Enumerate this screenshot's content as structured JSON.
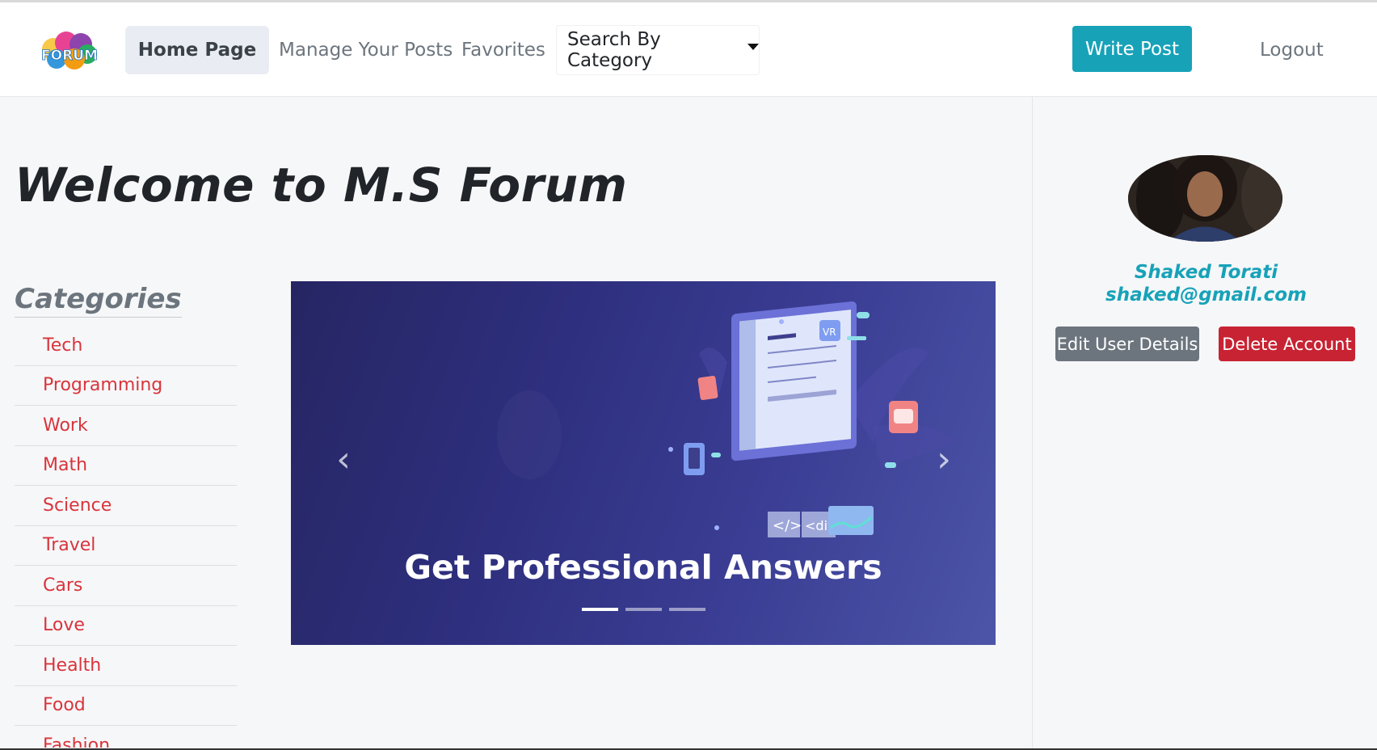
{
  "navbar": {
    "logo_text": "FORUM",
    "home": "Home Page",
    "manage": "Manage Your Posts",
    "favorites": "Favorites",
    "search_category": "Search By Category",
    "write_post": "Write Post",
    "logout": "Logout"
  },
  "main": {
    "welcome": "Welcome to M.S Forum",
    "categories_title": "Categories",
    "categories": [
      "Tech",
      "Programming",
      "Work",
      "Math",
      "Science",
      "Travel",
      "Cars",
      "Love",
      "Health",
      "Food",
      "Fashion"
    ]
  },
  "carousel": {
    "caption": "Get Professional Answers",
    "slide_count": 3,
    "active_slide": 1,
    "monitor_text": [
      "</>",
      "<div"
    ],
    "vr_label": "VR",
    "colors": {
      "bg_start": "#262563",
      "bg_end": "#4c55a8"
    }
  },
  "user": {
    "name": "Shaked Torati",
    "email": "shaked@gmail.com",
    "edit_button": "Edit User Details",
    "delete_button": "Delete Account"
  },
  "colors": {
    "accent": "#17a2b8",
    "danger": "#c82333",
    "secondary": "#6c757d",
    "category_link": "#d9343b"
  }
}
